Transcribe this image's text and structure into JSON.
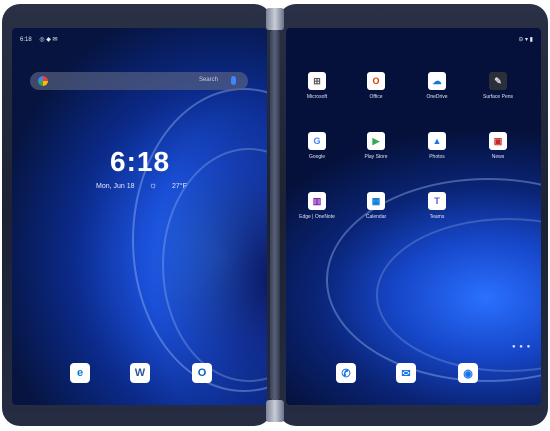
{
  "left_screen": {
    "status": {
      "time": "6:18",
      "icons": "◎ ◆ ✉"
    },
    "search": {
      "placeholder": "Search",
      "assistant_icon": "mic-icon"
    },
    "clock": "6:18",
    "date": "Mon, Jun 18",
    "temperature": "27°F",
    "dock": [
      {
        "name": "Edge",
        "glyph": "e",
        "color": "#0a7bd6"
      },
      {
        "name": "Word",
        "glyph": "W",
        "color": "#2b579a"
      },
      {
        "name": "Outlook",
        "glyph": "O",
        "color": "#0364b8"
      }
    ]
  },
  "right_screen": {
    "status": {
      "icons": "⊝ ▾ ▮"
    },
    "apps": [
      {
        "label": "Microsoft",
        "glyph": "⊞",
        "color": "#555555"
      },
      {
        "label": "Office",
        "glyph": "O",
        "color": "#d83b01"
      },
      {
        "label": "OneDrive",
        "glyph": "☁",
        "color": "#0f78d4"
      },
      {
        "label": "Surface Pens",
        "glyph": "✎",
        "color": "#444444"
      },
      {
        "label": "Google",
        "glyph": "G",
        "color": "#4285f4"
      },
      {
        "label": "Play Store",
        "glyph": "▶",
        "color": "#34a853"
      },
      {
        "label": "Photos",
        "glyph": "▲",
        "color": "#1a73e8"
      },
      {
        "label": "News",
        "glyph": "▣",
        "color": "#c62828"
      },
      {
        "label": "Edge | OneNote",
        "glyph": "▥",
        "color": "#7719aa"
      },
      {
        "label": "Calendar",
        "glyph": "▦",
        "color": "#0a7bd6"
      },
      {
        "label": "Teams",
        "glyph": "T",
        "color": "#5059c9"
      }
    ],
    "page_indicator": "● ● ●",
    "dock": [
      {
        "name": "Phone",
        "glyph": "✆",
        "color": "#1a73e8"
      },
      {
        "name": "Messages",
        "glyph": "✉",
        "color": "#1a73e8"
      },
      {
        "name": "Camera",
        "glyph": "◉",
        "color": "#1a73e8"
      }
    ]
  }
}
